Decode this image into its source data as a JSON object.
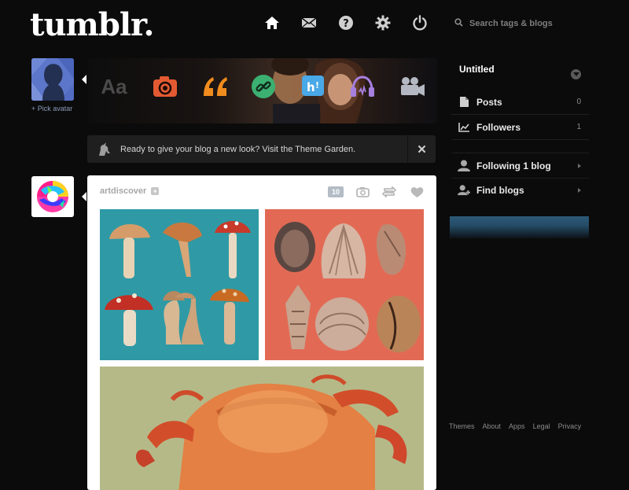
{
  "header": {
    "logo": "tumblr.",
    "nav_icons": [
      "home-icon",
      "mail-icon",
      "help-icon",
      "gear-icon",
      "power-icon"
    ],
    "search_placeholder": "Search tags & blogs"
  },
  "avatar": {
    "pick_label": "+ Pick avatar"
  },
  "post_types": [
    "text",
    "photo",
    "quote",
    "link",
    "chat",
    "audio",
    "video"
  ],
  "post_types_text_label": "Aa",
  "notice": {
    "text": "Ready to give your blog a new look? Visit the Theme Garden.",
    "close": "✕"
  },
  "post": {
    "author": "artdiscover",
    "follow": "+",
    "notes": "10",
    "controls": [
      "camera-icon",
      "reblog-icon",
      "heart-icon"
    ]
  },
  "sidebar": {
    "blog_title": "Untitled",
    "items": [
      {
        "label": "Posts",
        "count": "0"
      },
      {
        "label": "Followers",
        "count": "1"
      }
    ],
    "links": [
      {
        "label": "Following 1 blog"
      },
      {
        "label": "Find blogs"
      }
    ]
  },
  "footer": {
    "links": [
      "Themes",
      "About",
      "Apps",
      "Legal",
      "Privacy"
    ]
  },
  "colors": {
    "background": "#0b0b0b",
    "photo_orange": "#e35a32",
    "quote_orange": "#f08c1e",
    "link_green": "#3bb071",
    "chat_blue": "#49a8e6",
    "audio_purple": "#a77fe0",
    "video_gray": "#b4b8c2"
  }
}
